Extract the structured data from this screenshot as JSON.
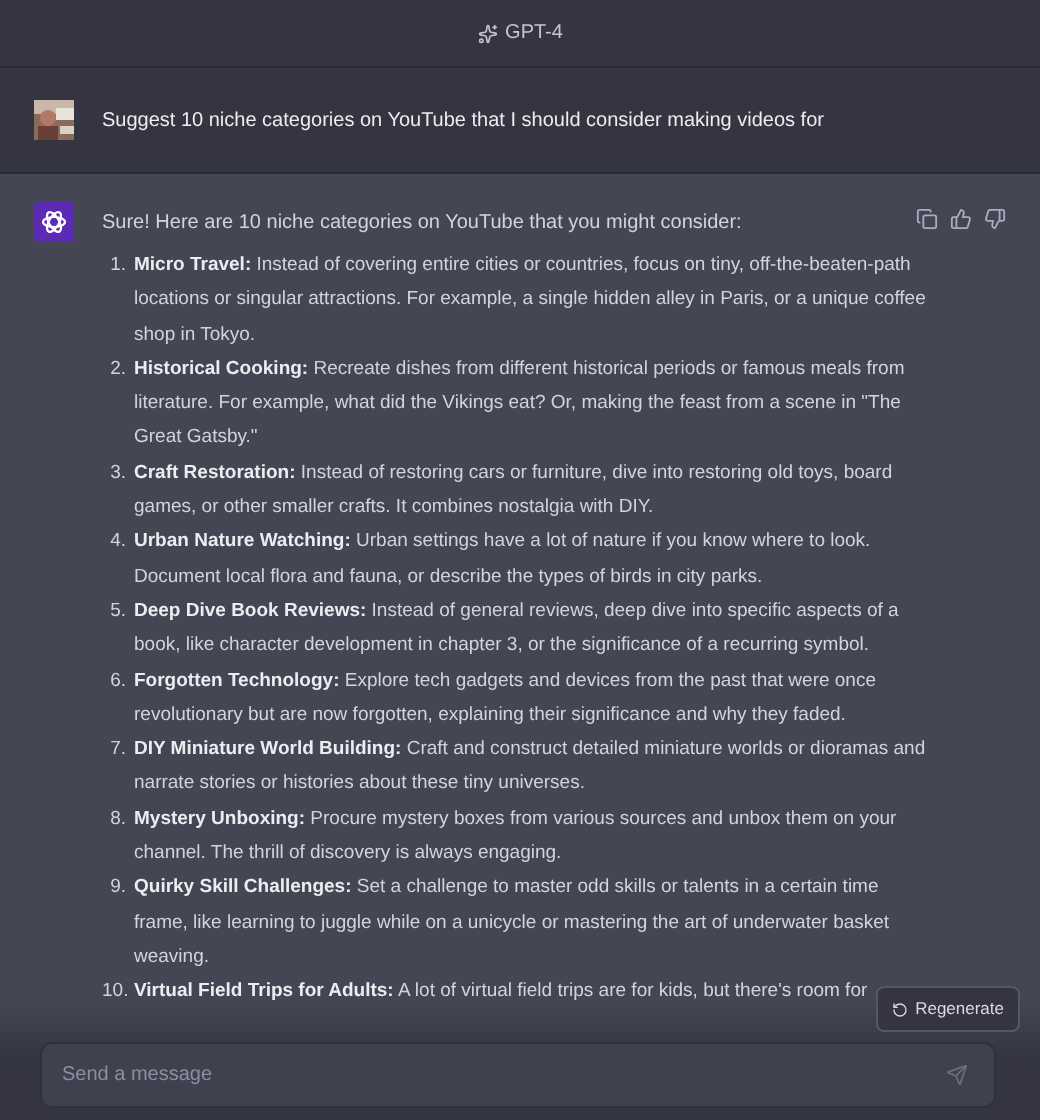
{
  "header": {
    "model": "GPT-4"
  },
  "user_message": {
    "text": "Suggest 10 niche categories on YouTube that I should consider making videos for"
  },
  "assistant_message": {
    "intro": "Sure! Here are 10 niche categories on YouTube that you might consider:",
    "items": [
      {
        "number": "1.",
        "title": "Micro Travel:",
        "text": "Instead of covering entire cities or countries, focus on tiny, off-the-beaten-path locations or singular attractions. For example, a single hidden alley in Paris, or a unique coffee shop in Tokyo."
      },
      {
        "number": "2.",
        "title": "Historical Cooking:",
        "text": "Recreate dishes from different historical periods or famous meals from literature. For example, what did the Vikings eat? Or, making the feast from a scene in \"The Great Gatsby.\""
      },
      {
        "number": "3.",
        "title": "Craft Restoration:",
        "text": "Instead of restoring cars or furniture, dive into restoring old toys, board games, or other smaller crafts. It combines nostalgia with DIY."
      },
      {
        "number": "4.",
        "title": "Urban Nature Watching:",
        "text": "Urban settings have a lot of nature if you know where to look. Document local flora and fauna, or describe the types of birds in city parks."
      },
      {
        "number": "5.",
        "title": "Deep Dive Book Reviews:",
        "text": "Instead of general reviews, deep dive into specific aspects of a book, like character development in chapter 3, or the significance of a recurring symbol."
      },
      {
        "number": "6.",
        "title": "Forgotten Technology:",
        "text": "Explore tech gadgets and devices from the past that were once revolutionary but are now forgotten, explaining their significance and why they faded."
      },
      {
        "number": "7.",
        "title": "DIY Miniature World Building:",
        "text": "Craft and construct detailed miniature worlds or dioramas and narrate stories or histories about these tiny universes."
      },
      {
        "number": "8.",
        "title": "Mystery Unboxing:",
        "text": "Procure mystery boxes from various sources and unbox them on your channel. The thrill of discovery is always engaging."
      },
      {
        "number": "9.",
        "title": "Quirky Skill Challenges:",
        "text": "Set a challenge to master odd skills or talents in a certain time frame, like learning to juggle while on a unicycle or mastering the art of underwater basket weaving."
      },
      {
        "number": "10.",
        "title": "Virtual Field Trips for Adults:",
        "text": "A lot of virtual field trips are for kids, but there's room for"
      }
    ]
  },
  "regenerate_button": {
    "label": "Regenerate"
  },
  "composer": {
    "placeholder": "Send a message"
  }
}
